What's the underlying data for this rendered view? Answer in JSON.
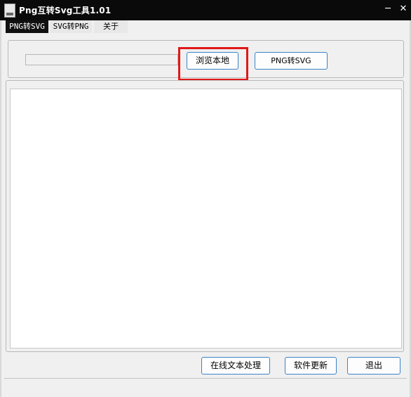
{
  "window": {
    "title": "Png互转Svg工具1.01",
    "minimize_glyph": "─",
    "close_glyph": "✕"
  },
  "tabs": [
    {
      "label": "PNG转SVG",
      "active": true
    },
    {
      "label": "SVG转PNG",
      "active": false
    },
    {
      "label": "关于",
      "active": false
    }
  ],
  "toolbar": {
    "path_value": "",
    "browse_label": "浏览本地",
    "convert_label": "PNG转SVG"
  },
  "output": {
    "text": ""
  },
  "footer": {
    "online_text_label": "在线文本处理",
    "update_label": "软件更新",
    "exit_label": "退出"
  },
  "colors": {
    "titlebar": "#0a0a0a",
    "button_border": "#3b82c8",
    "highlight": "#e01818",
    "active_tab": "#111111"
  }
}
